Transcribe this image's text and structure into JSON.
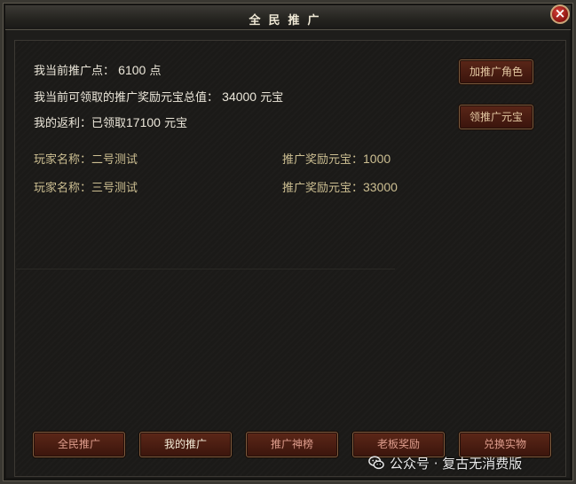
{
  "window": {
    "title": "全民推广",
    "close_label": "×"
  },
  "info": {
    "points_label": "我当前推广点：",
    "points_value": "6100",
    "points_unit": "点",
    "reward_label": "我当前可领取的推广奖励元宝总值：",
    "reward_value": "34000",
    "reward_unit": "元宝",
    "rebate_label": "我的返利：已领取",
    "rebate_value": "17100",
    "rebate_unit": "元宝"
  },
  "side_buttons": {
    "add_role": "加推广角色",
    "claim_ingot": "领推广元宝"
  },
  "players": [
    {
      "name_label": "玩家名称：",
      "name": "二号测试",
      "reward_label": "推广奖励元宝：",
      "reward": "1000"
    },
    {
      "name_label": "玩家名称：",
      "name": "三号测试",
      "reward_label": "推广奖励元宝：",
      "reward": "33000"
    }
  ],
  "tabs": [
    {
      "label": "全民推广",
      "active": false
    },
    {
      "label": "我的推广",
      "active": true
    },
    {
      "label": "推广神榜",
      "active": false
    },
    {
      "label": "老板奖励",
      "active": false
    },
    {
      "label": "兑换实物",
      "active": false
    }
  ],
  "watermark": {
    "text": "公众号 · 复古无消费版",
    "icon": "wechat-icon"
  },
  "colors": {
    "background": "#1b1a18",
    "info_text": "#ece7da",
    "player_text": "#cdbf92",
    "button_fill": "#4a1c12",
    "tab_text": "#dd9c8c",
    "active_tab_text": "#f4ecd8"
  }
}
